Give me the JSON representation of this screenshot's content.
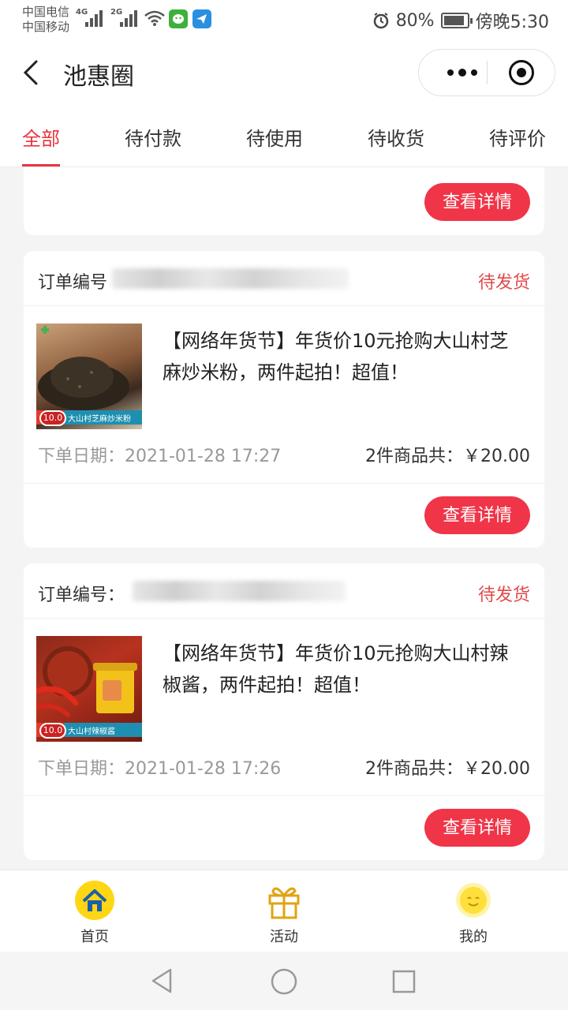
{
  "status_bar": {
    "carrier_1": "中国电信",
    "carrier_2": "中国移动",
    "net_1": "4G",
    "net_2": "2G",
    "battery": "80%",
    "time": "傍晚5:30"
  },
  "header": {
    "title": "池惠圈"
  },
  "tabs": [
    {
      "label": "全部",
      "active": true
    },
    {
      "label": "待付款",
      "active": false
    },
    {
      "label": "待使用",
      "active": false
    },
    {
      "label": "待收货",
      "active": false
    },
    {
      "label": "待评价",
      "active": false
    }
  ],
  "orders": [
    {
      "detail_button": "查看详情"
    },
    {
      "order_label": "订单编号",
      "status": "待发货",
      "title": "【网络年货节】年货价10元抢购大山村芝麻炒米粉，两件起拍！超值！",
      "thumb_caption": "大山村芝麻炒米粉",
      "thumb_badge": "10.0",
      "date": "下单日期：2021-01-28 17:27",
      "total": "2件商品共：￥20.00",
      "detail_button": "查看详情"
    },
    {
      "order_label": "订单编号：",
      "status": "待发货",
      "title": "【网络年货节】年货价10元抢购大山村辣椒酱，两件起拍！超值！",
      "thumb_caption": "大山村辣椒酱",
      "thumb_badge": "10.0",
      "date": "下单日期：2021-01-28 17:26",
      "total": "2件商品共：￥20.00",
      "detail_button": "查看详情"
    }
  ],
  "tabbar": [
    {
      "label": "首页",
      "icon": "home-icon"
    },
    {
      "label": "活动",
      "icon": "gift-icon"
    },
    {
      "label": "我的",
      "icon": "sun-face-icon"
    }
  ],
  "colors": {
    "accent": "#e8343f",
    "button": "#f03548",
    "status_text": "#e04b4b"
  }
}
